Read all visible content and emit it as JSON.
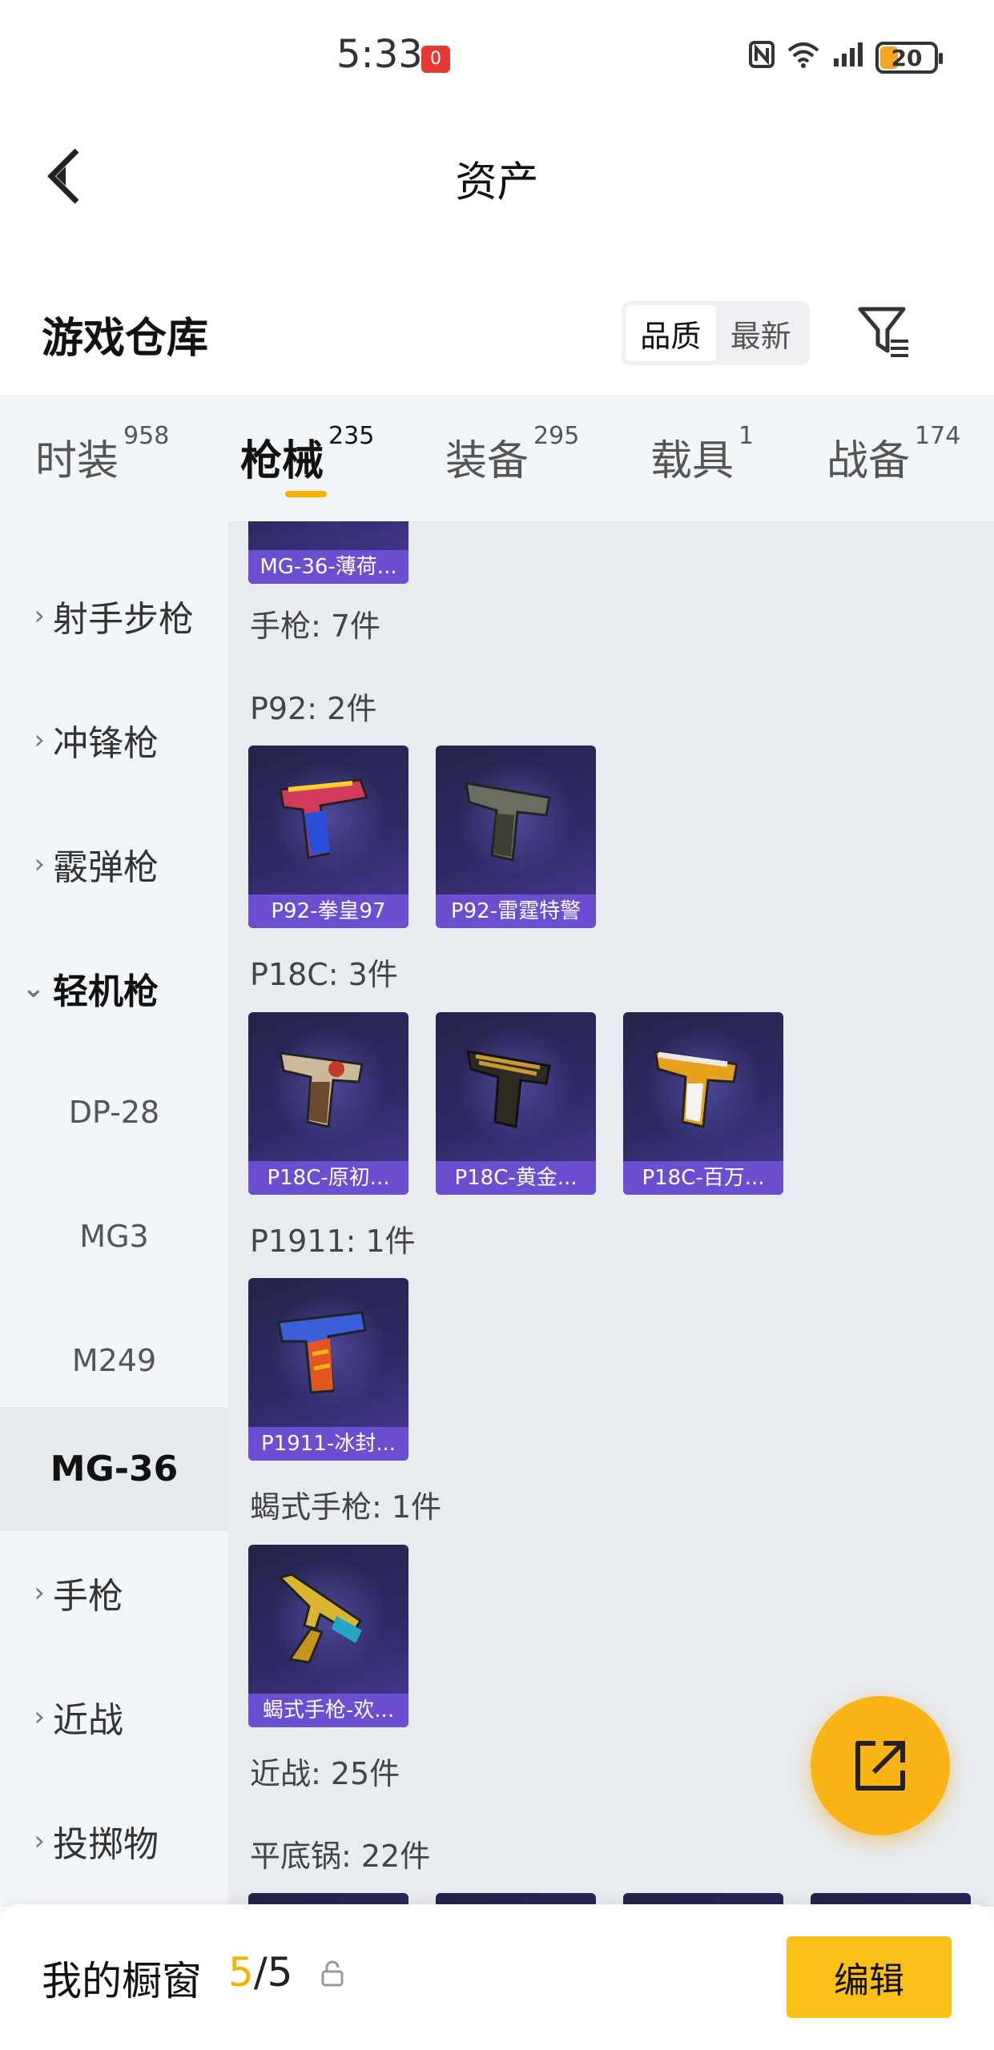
{
  "status_bar": {
    "time": "5:33",
    "notification_badge": "0",
    "battery": "20"
  },
  "nav": {
    "title": "资产"
  },
  "header": {
    "title": "游戏仓库",
    "sort_options": [
      "品质",
      "最新"
    ]
  },
  "tabs": [
    {
      "label": "时装",
      "count": "958"
    },
    {
      "label": "枪械",
      "count": "235"
    },
    {
      "label": "装备",
      "count": "295"
    },
    {
      "label": "载具",
      "count": "1"
    },
    {
      "label": "战备",
      "count": "174"
    }
  ],
  "sidebar": {
    "items": [
      {
        "label": "射手步枪",
        "chevron": "›"
      },
      {
        "label": "冲锋枪",
        "chevron": "›"
      },
      {
        "label": "霰弹枪",
        "chevron": "›"
      },
      {
        "label": "轻机枪",
        "chevron": "⌄"
      },
      {
        "label": "DP-28"
      },
      {
        "label": "MG3"
      },
      {
        "label": "M249"
      },
      {
        "label": "MG-36"
      },
      {
        "label": "手枪",
        "chevron": "›"
      },
      {
        "label": "近战",
        "chevron": "›"
      },
      {
        "label": "投掷物",
        "chevron": "›"
      }
    ]
  },
  "content": {
    "top_card": {
      "caption": "MG-36-薄荷..."
    },
    "sections": [
      {
        "label": "手枪: 7件"
      },
      {
        "label": "P92: 2件",
        "cards": [
          {
            "caption": "P92-拳皇97"
          },
          {
            "caption": "P92-雷霆特警"
          }
        ]
      },
      {
        "label": "P18C: 3件",
        "cards": [
          {
            "caption": "P18C-原初..."
          },
          {
            "caption": "P18C-黄金..."
          },
          {
            "caption": "P18C-百万..."
          }
        ]
      },
      {
        "label": "P1911: 1件",
        "cards": [
          {
            "caption": "P1911-冰封..."
          }
        ]
      },
      {
        "label": "蝎式手枪: 1件",
        "cards": [
          {
            "caption": "蝎式手枪-欢..."
          }
        ]
      },
      {
        "label": "近战: 25件"
      },
      {
        "label": "平底锅: 22件"
      }
    ]
  },
  "bottom_bar": {
    "label": "我的橱窗",
    "current": "5",
    "separator": "/",
    "total": "5",
    "edit_label": "编辑"
  },
  "colors": {
    "accent": "#f5b300",
    "card_caption": "#6b4fd0",
    "card_bg": "#2f2a66"
  }
}
